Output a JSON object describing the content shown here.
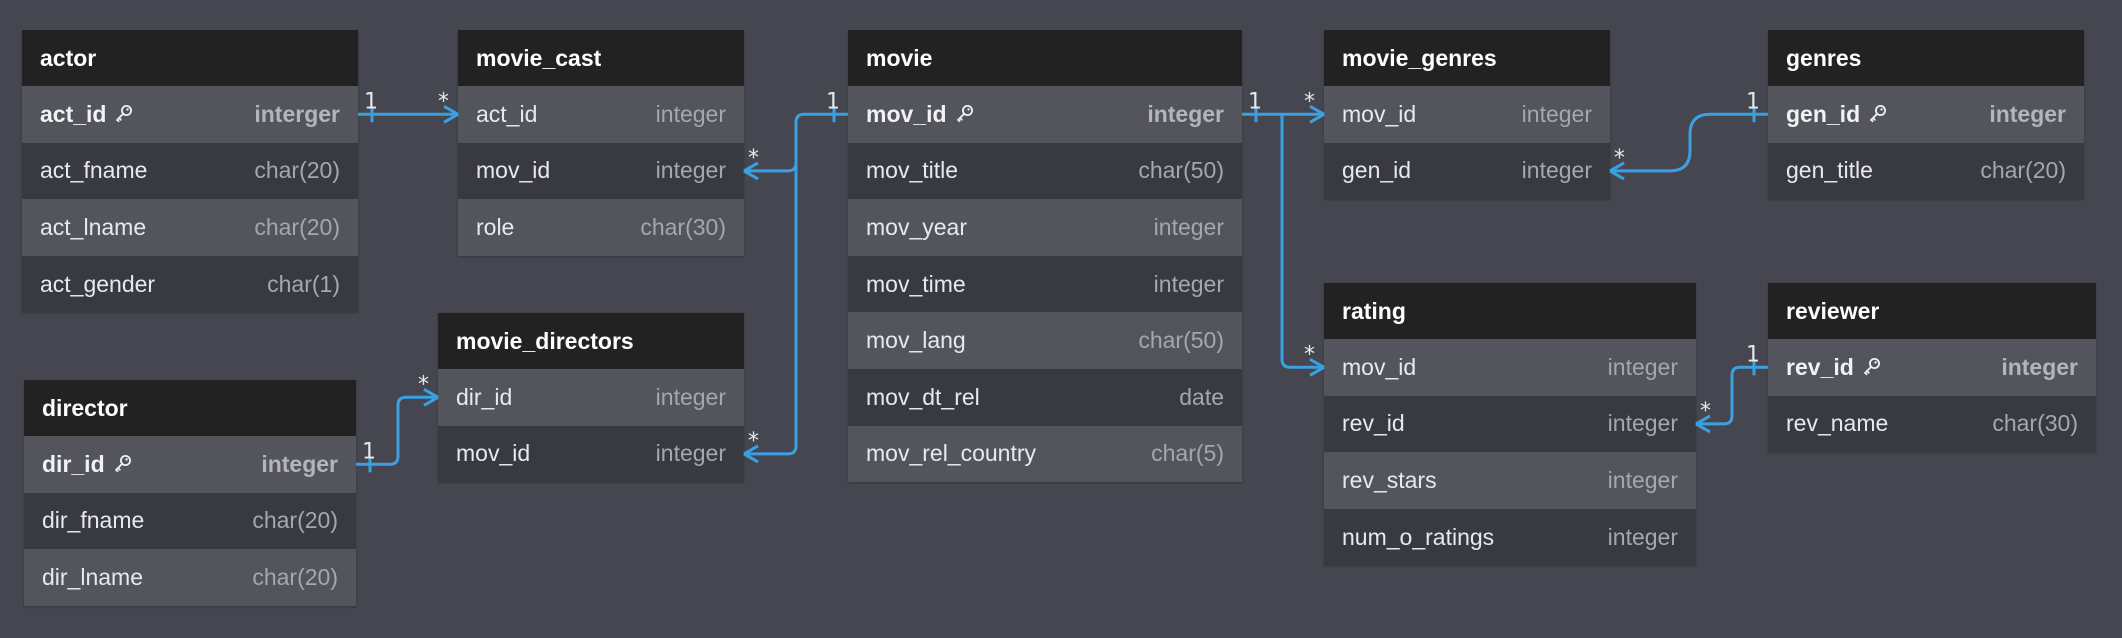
{
  "tables": {
    "actor": {
      "name": "actor",
      "columns": [
        {
          "name": "act_id",
          "type": "interger",
          "pk": true
        },
        {
          "name": "act_fname",
          "type": "char(20)"
        },
        {
          "name": "act_lname",
          "type": "char(20)"
        },
        {
          "name": "act_gender",
          "type": "char(1)"
        }
      ]
    },
    "director": {
      "name": "director",
      "columns": [
        {
          "name": "dir_id",
          "type": "integer",
          "pk": true
        },
        {
          "name": "dir_fname",
          "type": "char(20)"
        },
        {
          "name": "dir_lname",
          "type": "char(20)"
        }
      ]
    },
    "movie_cast": {
      "name": "movie_cast",
      "columns": [
        {
          "name": "act_id",
          "type": "integer"
        },
        {
          "name": "mov_id",
          "type": "integer"
        },
        {
          "name": "role",
          "type": "char(30)"
        }
      ]
    },
    "movie_directors": {
      "name": "movie_directors",
      "columns": [
        {
          "name": "dir_id",
          "type": "integer"
        },
        {
          "name": "mov_id",
          "type": "integer"
        }
      ]
    },
    "movie": {
      "name": "movie",
      "columns": [
        {
          "name": "mov_id",
          "type": "integer",
          "pk": true
        },
        {
          "name": "mov_title",
          "type": "char(50)"
        },
        {
          "name": "mov_year",
          "type": "integer"
        },
        {
          "name": "mov_time",
          "type": "integer"
        },
        {
          "name": "mov_lang",
          "type": "char(50)"
        },
        {
          "name": "mov_dt_rel",
          "type": "date"
        },
        {
          "name": "mov_rel_country",
          "type": "char(5)"
        }
      ]
    },
    "movie_genres": {
      "name": "movie_genres",
      "columns": [
        {
          "name": "mov_id",
          "type": "integer"
        },
        {
          "name": "gen_id",
          "type": "integer"
        }
      ]
    },
    "genres": {
      "name": "genres",
      "columns": [
        {
          "name": "gen_id",
          "type": "integer",
          "pk": true
        },
        {
          "name": "gen_title",
          "type": "char(20)"
        }
      ]
    },
    "rating": {
      "name": "rating",
      "columns": [
        {
          "name": "mov_id",
          "type": "integer"
        },
        {
          "name": "rev_id",
          "type": "integer"
        },
        {
          "name": "rev_stars",
          "type": "integer"
        },
        {
          "name": "num_o_ratings",
          "type": "integer"
        }
      ]
    },
    "reviewer": {
      "name": "reviewer",
      "columns": [
        {
          "name": "rev_id",
          "type": "integer",
          "pk": true
        },
        {
          "name": "rev_name",
          "type": "char(30)"
        }
      ]
    }
  },
  "relations": [
    {
      "from": "actor.act_id",
      "to": "movie_cast.act_id",
      "from_card": "1",
      "to_card": "*"
    },
    {
      "from": "director.dir_id",
      "to": "movie_directors.dir_id",
      "from_card": "1",
      "to_card": "*"
    },
    {
      "from": "movie.mov_id",
      "to": "movie_cast.mov_id",
      "from_card": "1",
      "to_card": "*"
    },
    {
      "from": "movie.mov_id",
      "to": "movie_directors.mov_id",
      "from_card": "1",
      "to_card": "*"
    },
    {
      "from": "movie.mov_id",
      "to": "movie_genres.mov_id",
      "from_card": "1",
      "to_card": "*"
    },
    {
      "from": "movie.mov_id",
      "to": "rating.mov_id",
      "from_card": "1",
      "to_card": "*"
    },
    {
      "from": "genres.gen_id",
      "to": "movie_genres.gen_id",
      "from_card": "1",
      "to_card": "*"
    },
    {
      "from": "reviewer.rev_id",
      "to": "rating.rev_id",
      "from_card": "1",
      "to_card": "*"
    }
  ],
  "colors": {
    "background": "#464650",
    "header": "#222222",
    "row_alt": "#54545d",
    "row_base": "#393941",
    "link": "#3aa0e0"
  },
  "icons": {
    "primary_key": "key-icon"
  }
}
